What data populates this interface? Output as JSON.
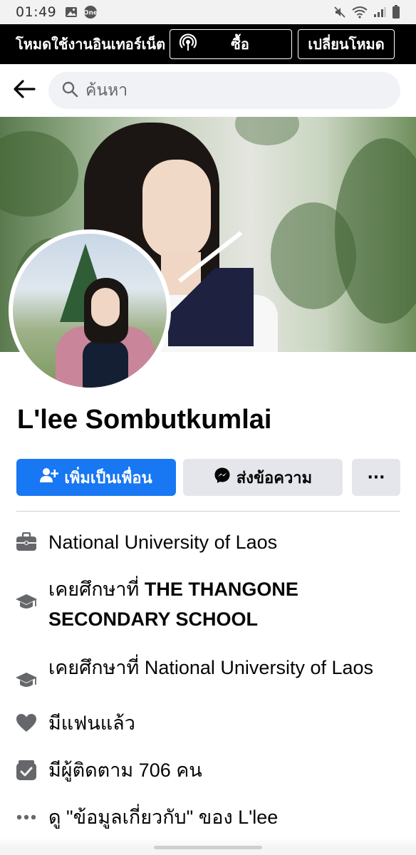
{
  "status_bar": {
    "time": "01:49",
    "left_icons": [
      "image-icon",
      "one-app-icon"
    ],
    "right_icons": [
      "mute-icon",
      "wifi-icon",
      "signal-icon",
      "battery-icon"
    ]
  },
  "data_mode_bar": {
    "label": "โหมดใช้งานอินเทอร์เน็ต",
    "buy_label": "ซื้อ",
    "switch_label": "เปลี่ยนโหมด"
  },
  "search": {
    "placeholder": "ค้นหา"
  },
  "profile": {
    "name": "L'lee Sombutkumlai"
  },
  "actions": {
    "add_friend_label": "เพิ่มเป็นเพื่อน",
    "message_label": "ส่งข้อความ",
    "more_label": "···"
  },
  "info": {
    "work": "National University of Laos",
    "school1_prefix": "เคยศึกษาที่ ",
    "school1_name": "THE THANGONE SECONDARY SCHOOL",
    "school2_prefix": "เคยศึกษาที่ ",
    "school2_name": "National University of Laos",
    "relationship": "มีแฟนแล้ว",
    "followers": "มีผู้ติดตาม 706 คน",
    "about_partial": "ดู \"ข้อมูลเกี่ยวกับ\" ของ L'lee"
  },
  "colors": {
    "accent": "#1877f2",
    "secondary_button": "#e4e6eb",
    "icon_gray": "#65676b",
    "mode_bar": "#000000"
  }
}
